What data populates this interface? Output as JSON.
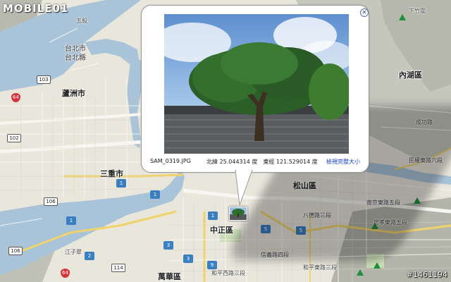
{
  "watermark": {
    "logo_text": "MOBILE01",
    "id_text": "#1461194"
  },
  "map": {
    "labels": {
      "taipei_city": "台北市",
      "taipei_county": "台北縣",
      "luzhou": "蘆洲市",
      "sanchong": "三重市",
      "neihu": "內湖區",
      "songshan": "松山區",
      "zhongzheng": "中正區",
      "wanhua": "萬華區"
    },
    "minor_labels": {
      "road_taibei": "台北市",
      "road_1": "八德路三段",
      "road_2": "南京東路五段",
      "road_3": "忠孝東路五段",
      "road_4": "和平東路三段",
      "road_5": "信義路四段",
      "road_6": "和平西路三段",
      "road_7": "江子翠",
      "road_8": "民權東路六段",
      "road_9": "成功路",
      "road_10": "五股",
      "road_11": "下竹圍"
    },
    "route_shields": {
      "r1": "1",
      "r1b": "1",
      "r1c": "1",
      "r1d": "1",
      "r2": "2",
      "r3": "3",
      "r3b": "3",
      "r5": "5",
      "r5b": "5",
      "r9": "9",
      "r102": "102",
      "r103": "103",
      "r106": "106",
      "r106b": "106",
      "r114": "114",
      "r64": "64",
      "r64b": "64"
    },
    "colors": {
      "water": "#a9c3d9",
      "land": "#e9e6dc",
      "mountain": "#bdbfb5",
      "road_major": "#f4f2ee",
      "road_arterial": "#f2d86a",
      "park": "#c8dcb4"
    }
  },
  "popup": {
    "filename": "SAM_0319.JPG",
    "coordinates": "北緯 25.044314 度　東經 121.529014 度",
    "enlarge_link": "檢視完整大小",
    "close_icon": "close-icon"
  }
}
